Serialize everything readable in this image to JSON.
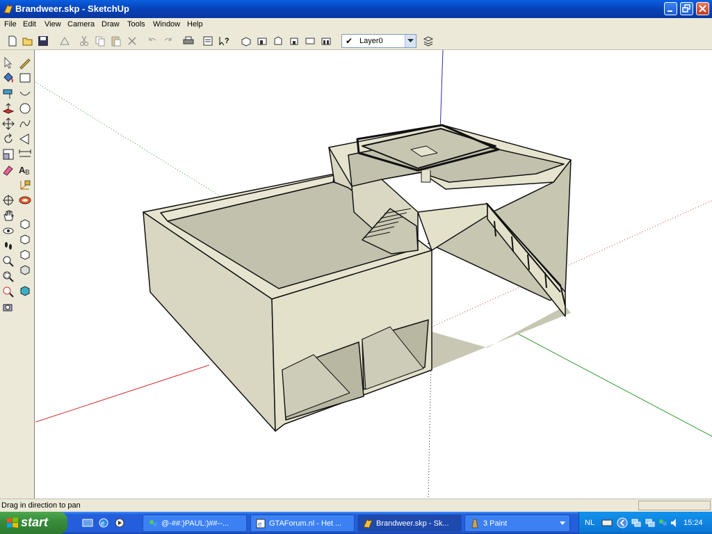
{
  "window": {
    "title": "Brandweer.skp - SketchUp",
    "icon": "sketchup-icon"
  },
  "menubar": {
    "items": [
      "File",
      "Edit",
      "View",
      "Camera",
      "Draw",
      "Tools",
      "Window",
      "Help"
    ]
  },
  "toolbar": {
    "layer": "Layer0",
    "icons": [
      "new-icon",
      "open-icon",
      "save-icon",
      "make-component-icon",
      "cut-icon",
      "copy-icon",
      "paste-icon",
      "erase-icon",
      "undo-icon",
      "redo-icon",
      "print-icon",
      "model-info-icon",
      "context-help-icon",
      "iso-view-icon",
      "top-view-icon",
      "front-view-icon",
      "right-view-icon",
      "back-view-icon",
      "left-view-icon",
      "layers-icon"
    ]
  },
  "left_tools": {
    "icons": [
      "select-icon",
      "pencil-icon",
      "paint-bucket-icon",
      "rectangle-icon",
      "tape-measure-icon",
      "arc-icon",
      "push-pull-icon",
      "circle-icon",
      "move-icon",
      "freehand-icon",
      "rotate-icon",
      "polygon-icon",
      "scale-icon",
      "dimension-icon",
      "eraser-icon",
      "text-icon",
      "axes-icon",
      "orbit-icon",
      "pan-icon",
      "zoom-icon",
      "zoom-window-icon",
      "zoom-extents-icon"
    ]
  },
  "status": {
    "text": "Drag in direction to pan"
  },
  "taskbar": {
    "start_label": "start",
    "tasks": [
      {
        "label": "@-##:)PAUL:)##--...",
        "icon": "messenger-icon"
      },
      {
        "label": "GTAForum.nl - Het ...",
        "icon": "browser-icon"
      },
      {
        "label": "Brandweer.skp - Sk...",
        "icon": "sketchup-icon"
      },
      {
        "label": "3 Paint",
        "icon": "paint-icon"
      }
    ],
    "language": "NL",
    "clock": "15:24"
  },
  "colors": {
    "wall": "#e4e1cb",
    "floor": "#c2c1ad",
    "shadow": "#b8b7a2",
    "axis_red": "#d03030",
    "axis_green": "#2f9a2f",
    "axis_blue": "#2a2ab0"
  }
}
